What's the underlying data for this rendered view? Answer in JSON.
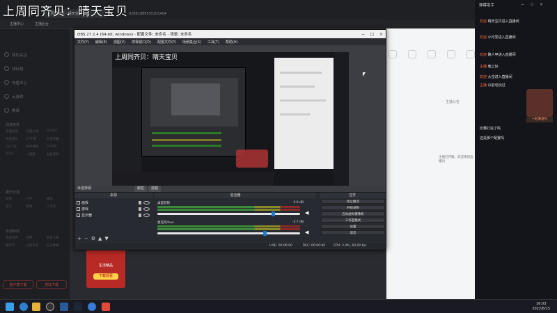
{
  "watermark": "上周同齐贝：晴天宝贝",
  "browser": {
    "tab_label": "上周同齐贝 · 晴天宝贝",
    "url_fragment": "02681989535201404",
    "bookmarks": [
      "主播中心",
      "主播后台"
    ]
  },
  "left_nav": {
    "items": [
      "我的关注",
      "排行榜",
      "充值中心",
      "云游戏",
      "赛事"
    ],
    "sections": [
      {
        "title": "网游竞技",
        "entries": [
          "英雄联盟",
          "穿越火线",
          "DOTA2",
          "绝地求生",
          "CF手游",
          "王者荣耀",
          "QQ飞车",
          "和平精英",
          "CS:GO",
          "APEX",
          "一起看",
          "主机游戏"
        ]
      },
      {
        "title": "娱乐天地",
        "entries": [
          "颜值",
          "户外",
          "舞蹈",
          "音乐",
          "星秀",
          "二次元"
        ]
      },
      {
        "title": "手游休闲",
        "entries": [
          "我的世界",
          "原神",
          "第五人格",
          "金铲铲",
          "火影手游",
          "天天象棋"
        ]
      }
    ],
    "btn_left": "客户端下载",
    "btn_right": "游戏下载"
  },
  "promo": {
    "title": "生活精品",
    "button": "下载观看"
  },
  "obs": {
    "title": "OBS 27.2.4 (64-bit, windows) - 配置文件: 未命名 - 场景: 未命名",
    "menu": [
      "文件(F)",
      "编辑(E)",
      "视图(V)",
      "停靠窗口(D)",
      "配置文件(P)",
      "场景集合(S)",
      "工具(T)",
      "帮助(H)"
    ],
    "scene_header": "未选择源",
    "source_tabs": [
      "属性",
      "滤镜"
    ],
    "dock_headers": {
      "scenes": "来源",
      "mixer": "混音器",
      "controls": "控件"
    },
    "sources": [
      "画板",
      "游戏",
      "显示器"
    ],
    "mixer": [
      {
        "name": "桌面音频",
        "db": "0.0 dB",
        "level": 0.82
      },
      {
        "name": "麦克风/Aux",
        "db": "-3.7 dB",
        "level": 0.76
      }
    ],
    "controls": [
      "停止推流",
      "开始录制",
      "启动虚拟摄像机",
      "工作室模式",
      "设置",
      "退出"
    ],
    "status": {
      "live": "LIVE: 00:00:00",
      "rec": "REC: 00:00:00",
      "cpu": "CPU: 2.4%, 60.00 fps"
    }
  },
  "right_page": {
    "tab": "主播公告",
    "notice": "主播已开播，欢迎来到直播间"
  },
  "chat": {
    "title": "弹幕助手",
    "messages": [
      {
        "user": "欢迎",
        "text": "晴天宝贝进入直播间"
      },
      {
        "user": "欢迎",
        "text": "小可爱进入直播间"
      },
      {
        "user": "欢迎",
        "text": "路人甲进入直播间"
      },
      {
        "user": "主播",
        "text": "晚上好"
      },
      {
        "user": "欢迎",
        "text": "大宝进入直播间"
      },
      {
        "user": "主播",
        "text": "以前也玩过"
      },
      {
        "user": "",
        "text": "比赛打完了吗"
      },
      {
        "user": "",
        "text": "还是那个配置吗"
      }
    ],
    "gift_label": "一起来送礼"
  },
  "taskbar": {
    "time": "16:03",
    "date": "2022/6/15"
  },
  "colors": {
    "accent": "#ff6a3c",
    "obs_blue": "#1d7bd1",
    "promo_red": "#b72a25"
  }
}
